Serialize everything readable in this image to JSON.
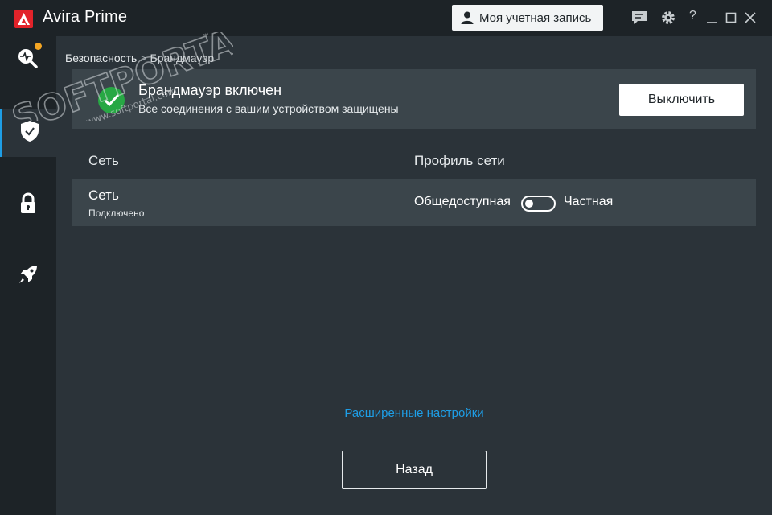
{
  "app": {
    "title": "Avira Prime"
  },
  "header": {
    "account_label": "Моя учетная запись",
    "icons": [
      "feedback-icon",
      "gear-icon",
      "help-icon",
      "minimize-icon",
      "maximize-icon",
      "close-icon"
    ],
    "help_glyph": "?"
  },
  "sidebar": {
    "items": [
      {
        "name": "scan",
        "icon": "scan-icon",
        "has_alert": true
      },
      {
        "name": "security",
        "icon": "shield-icon",
        "active": true
      },
      {
        "name": "privacy",
        "icon": "lock-icon"
      },
      {
        "name": "performance",
        "icon": "rocket-icon"
      }
    ]
  },
  "breadcrumb": {
    "parent": "Безопасность",
    "separator": ">",
    "current": "Брандмауэр"
  },
  "status": {
    "title": "Брандмауэр включен",
    "subtitle": "Все соединения с вашим устройством защищены",
    "button": "Выключить"
  },
  "table": {
    "headers": [
      "Сеть",
      "Профиль сети"
    ],
    "rows": [
      {
        "name": "Сеть",
        "state": "Подключено",
        "profile_left": "Общедоступная",
        "profile_right": "Частная",
        "toggle_private": false
      }
    ]
  },
  "advanced_link": "Расширенные настройки",
  "back_button": "Назад",
  "watermark": {
    "text": "SOFTPORTAL",
    "url": "www.softportal.com",
    "tm": "™"
  },
  "colors": {
    "accent": "#1e9ee6",
    "brand": "#e2232a",
    "ok": "#27a844",
    "alert": "#f5a623"
  }
}
